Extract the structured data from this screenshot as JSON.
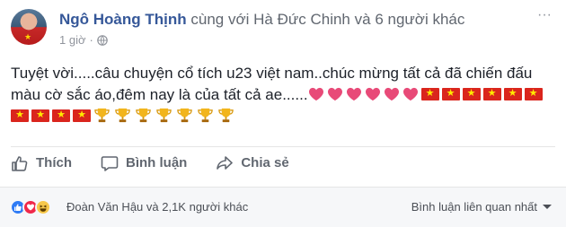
{
  "post": {
    "author": "Ngô Hoàng Thịnh",
    "with_text": "cùng với",
    "tagged": "Hà Đức Chinh",
    "and_text": "và",
    "others": "6 người khác",
    "time": "1 giờ",
    "more": "···",
    "text": "Tuyệt vời.....câu chuyện cổ tích u23 việt nam..chúc mừng tất cả đã chiến đấu màu cờ sắc áo,đêm nay là của tất cả ae......",
    "emoji": {
      "hearts": 6,
      "flags_line1": 6,
      "flags_line2": 4,
      "trophies": 7
    }
  },
  "actions": {
    "like": "Thích",
    "comment": "Bình luận",
    "share": "Chia sẻ"
  },
  "footer": {
    "reaction_names": "Đoàn Văn Hậu và 2,1K người khác",
    "sort_label": "Bình luận liên quan nhất"
  },
  "colors": {
    "link": "#365899",
    "muted": "#90949c",
    "heart": "#e84a78",
    "flag": "#da251d",
    "like": "#2f7bf5",
    "love": "#f0284a"
  },
  "icons": [
    "globe-icon",
    "more-icon",
    "like-icon",
    "comment-icon",
    "share-icon",
    "heart-emoji",
    "vietnam-flag-emoji",
    "trophy-emoji",
    "like-reaction-icon",
    "love-reaction-icon",
    "haha-reaction-icon",
    "caret-down-icon"
  ]
}
